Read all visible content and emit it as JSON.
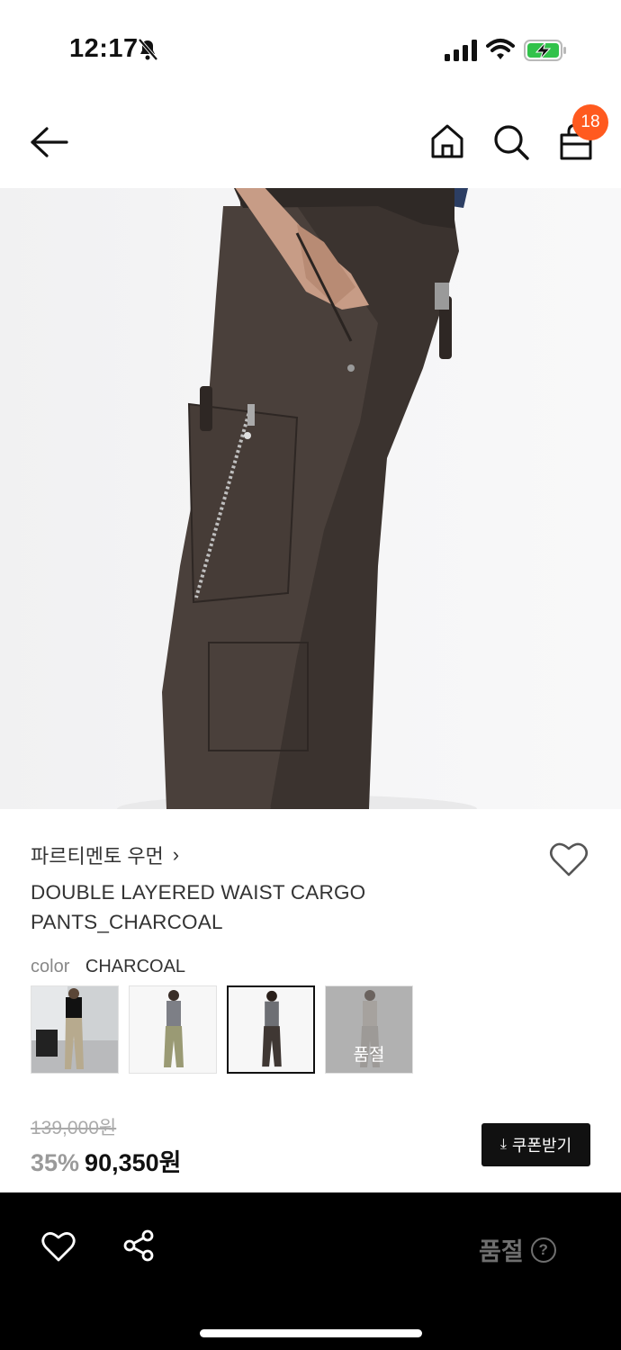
{
  "status_bar": {
    "time": "12:17",
    "icons": [
      "bell-slash-icon",
      "cellular-signal-icon",
      "wifi-icon",
      "battery-charging-icon"
    ]
  },
  "header": {
    "icons": [
      "back-arrow-icon",
      "home-icon",
      "search-icon",
      "shopping-bag-icon"
    ],
    "cart_count": "18"
  },
  "gallery": {
    "image_description": "Model wearing charcoal cargo pants, side view",
    "progress_fraction": 0.83
  },
  "product": {
    "brand": "파르티멘토 우먼",
    "name": "DOUBLE LAYERED WAIST CARGO PANTS_CHARCOAL",
    "color_label": "color",
    "color_value": "CHARCOAL",
    "swatches": [
      {
        "label": "",
        "sold_out": false,
        "selected": false
      },
      {
        "label": "",
        "sold_out": false,
        "selected": false
      },
      {
        "label": "",
        "sold_out": false,
        "selected": true
      },
      {
        "label": "품절",
        "sold_out": true,
        "selected": false
      }
    ],
    "original_price": "139,000원",
    "discount": "35%",
    "final_price": "90,350원",
    "coupon_button": "쿠폰받기"
  },
  "bottom_bar": {
    "soldout_label": "품절",
    "help_symbol": "?"
  },
  "colors": {
    "badge": "#ff5a1f",
    "primary": "#111111",
    "bottom_bar_bg": "#000000",
    "muted": "#9a9a9a"
  }
}
